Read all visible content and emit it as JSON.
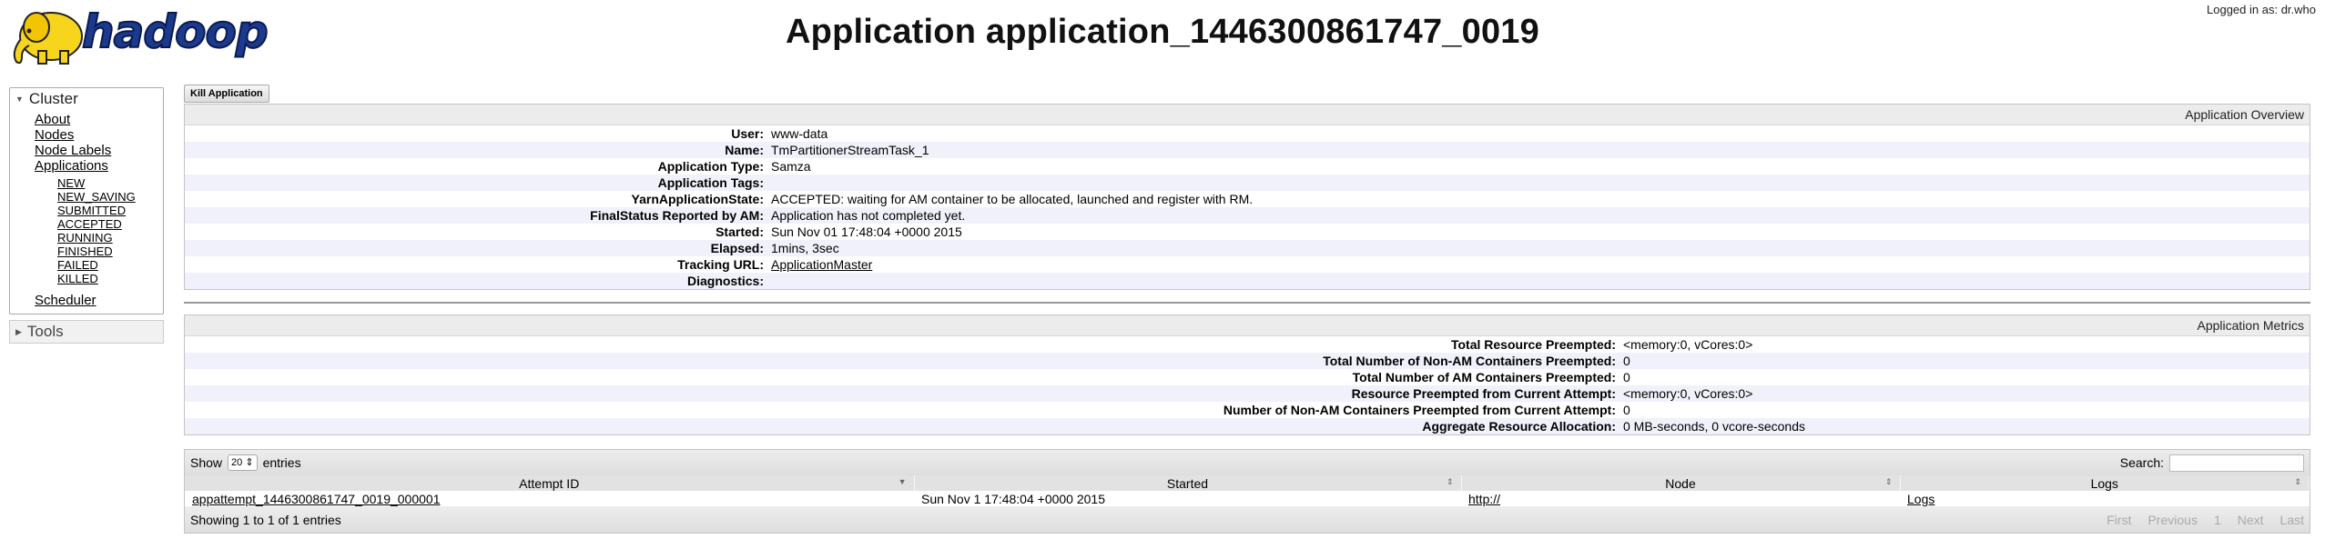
{
  "header": {
    "logo_text": "hadoop",
    "title": "Application application_1446300861747_0019",
    "logged_in": "Logged in as: dr.who"
  },
  "sidebar": {
    "cluster_label": "Cluster",
    "items": [
      "About",
      "Nodes",
      "Node Labels",
      "Applications"
    ],
    "app_states": [
      "NEW",
      "NEW_SAVING",
      "SUBMITTED",
      "ACCEPTED",
      "RUNNING",
      "FINISHED",
      "FAILED",
      "KILLED"
    ],
    "scheduler": "Scheduler",
    "tools_label": "Tools"
  },
  "kill_button": "Kill Application",
  "overview": {
    "title": "Application Overview",
    "rows": [
      {
        "key": "User:",
        "value": "www-data"
      },
      {
        "key": "Name:",
        "value": "TmPartitionerStreamTask_1"
      },
      {
        "key": "Application Type:",
        "value": "Samza"
      },
      {
        "key": "Application Tags:",
        "value": ""
      },
      {
        "key": "YarnApplicationState:",
        "value": "ACCEPTED: waiting for AM container to be allocated, launched and register with RM."
      },
      {
        "key": "FinalStatus Reported by AM:",
        "value": "Application has not completed yet."
      },
      {
        "key": "Started:",
        "value": "Sun Nov 01 17:48:04 +0000 2015"
      },
      {
        "key": "Elapsed:",
        "value": "1mins, 3sec"
      },
      {
        "key": "Tracking URL:",
        "value": "ApplicationMaster",
        "link": true
      },
      {
        "key": "Diagnostics:",
        "value": ""
      }
    ]
  },
  "metrics": {
    "title": "Application Metrics",
    "rows": [
      {
        "key": "Total Resource Preempted:",
        "value": "<memory:0, vCores:0>"
      },
      {
        "key": "Total Number of Non-AM Containers Preempted:",
        "value": "0"
      },
      {
        "key": "Total Number of AM Containers Preempted:",
        "value": "0"
      },
      {
        "key": "Resource Preempted from Current Attempt:",
        "value": "<memory:0, vCores:0>"
      },
      {
        "key": "Number of Non-AM Containers Preempted from Current Attempt:",
        "value": "0"
      },
      {
        "key": "Aggregate Resource Allocation:",
        "value": "0 MB-seconds, 0 vcore-seconds"
      }
    ]
  },
  "attempts": {
    "show_label": "Show",
    "page_size": "20",
    "entries_label": "entries",
    "search_label": "Search:",
    "columns": [
      "Attempt ID",
      "Started",
      "Node",
      "Logs"
    ],
    "rows": [
      {
        "attempt_id": "appattempt_1446300861747_0019_000001",
        "started": "Sun Nov 1 17:48:04 +0000 2015",
        "node": "http://",
        "logs": "Logs"
      }
    ],
    "info": "Showing 1 to 1 of 1 entries",
    "pager": [
      "First",
      "Previous",
      "1",
      "Next",
      "Last"
    ]
  }
}
